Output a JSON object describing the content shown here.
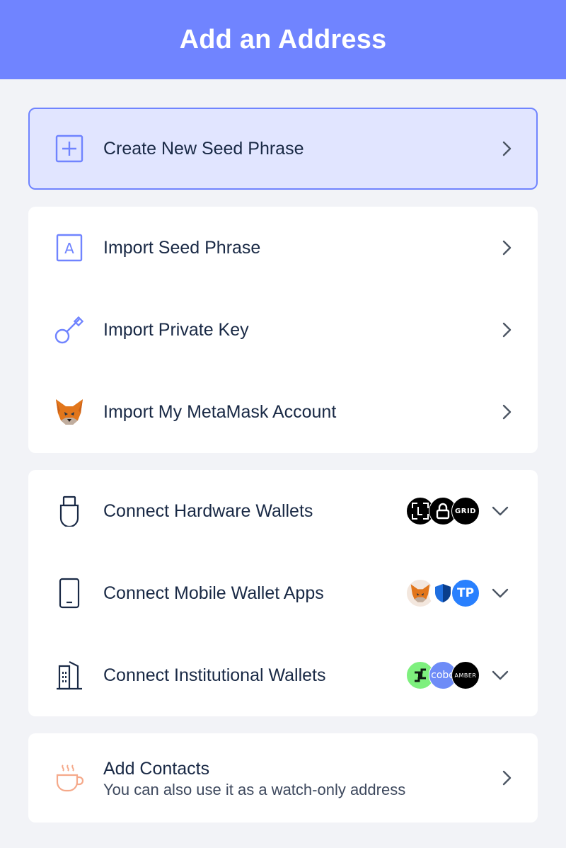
{
  "header": {
    "title": "Add an Address"
  },
  "create": {
    "label": "Create New Seed Phrase"
  },
  "imports": [
    {
      "label": "Import Seed Phrase"
    },
    {
      "label": "Import Private Key"
    },
    {
      "label": "Import My MetaMask Account"
    }
  ],
  "connect": [
    {
      "label": "Connect Hardware Wallets",
      "badges": [
        "ledger",
        "keystone",
        "GRID"
      ]
    },
    {
      "label": "Connect Mobile Wallet Apps",
      "badges": [
        "metamask",
        "safe",
        "TP"
      ]
    },
    {
      "label": "Connect Institutional Wallets",
      "badges": [
        "gnosis",
        "cobo",
        "AMBER"
      ]
    }
  ],
  "contacts": {
    "title": "Add Contacts",
    "subtitle": "You can also use it as a watch-only address"
  },
  "badge_text": {
    "grid": "GRID",
    "tp": "TP",
    "cobo": "cobo",
    "amber": "AMBER"
  },
  "colors": {
    "accent": "#7084ff",
    "accent_light": "#e1e5ff",
    "text": "#192945",
    "subtext": "#3e495e",
    "background": "#f2f3f7"
  }
}
